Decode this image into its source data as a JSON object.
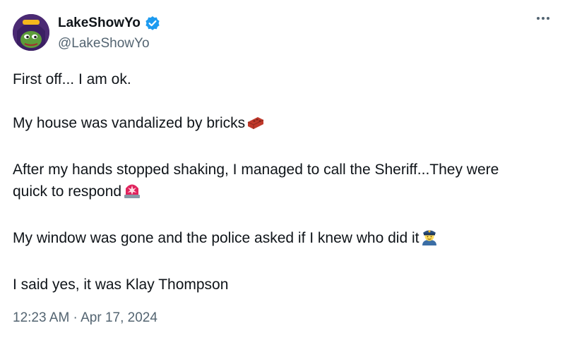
{
  "author": {
    "display_name": "LakeShowYo",
    "handle": "@LakeShowYo",
    "verified": true,
    "verified_color": "#1d9bf0"
  },
  "more_menu": {
    "icon": "more-horizontal-icon"
  },
  "tweet": {
    "paragraphs": [
      {
        "text": "First off... I am ok.",
        "emoji": ""
      },
      {
        "text": "My house was vandalized by bricks",
        "emoji": "brick-emoji"
      },
      {
        "text": "After my hands stopped shaking, I managed to call the Sheriff...They were quick to respond",
        "emoji": "police-light-emoji"
      },
      {
        "text": "My window was gone and the police asked if I knew who did it",
        "emoji": "police-officer-emoji"
      },
      {
        "text": "I said yes, it was Klay Thompson",
        "emoji": ""
      }
    ]
  },
  "meta": {
    "timestamp": "12:23 AM · Apr 17, 2024"
  }
}
